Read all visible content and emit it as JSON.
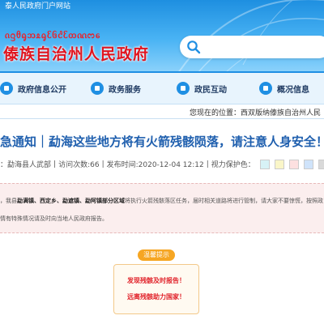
{
  "header": {
    "top_link": "泰人民政府门户网站",
    "script_line": "ᦵᦋᦲᧂᦘᦸᧂᦷᦑᦺᦷᦎᦶᦂᧈ",
    "site_title": "傣族自治州人民政府",
    "search_placeholder": ""
  },
  "nav": {
    "items": [
      {
        "label": "政府信息公开",
        "icon": "document-icon"
      },
      {
        "label": "政务服务",
        "icon": "service-icon"
      },
      {
        "label": "政民互动",
        "icon": "chat-icon"
      },
      {
        "label": "概况信息",
        "icon": "info-icon"
      }
    ]
  },
  "breadcrumb": "您现在的位置：西双版纳傣族自治州人民",
  "article": {
    "title": "急通知｜勐海这些地方将有火箭残骸陨落，请注意人身安全！",
    "meta": {
      "source": "：勐海县人武部",
      "views": "访问次数:66",
      "time": "发布时间:2020-12-04 12:12",
      "vision_label": "视力保护色："
    },
    "swatches": [
      "#d7f2f6",
      "#faf6c8",
      "#fde0e0",
      "#cfe3fa",
      "#d9d9d9"
    ],
    "para_1_prefix": "，我县",
    "para_1_bold": "勐满镇、西定乡、勐遮镇、勐阿镇部分区域",
    "para_1_rest": "将执行火箭残骸落区任务，届时相关道路将进行管制，请大家不要惊慌，按照政",
    "para_2": "情有特殊情况请及时向当地人民政府报告。"
  },
  "notice": {
    "badge": "温馨提示",
    "line_1": "发现残骸及时报告！",
    "line_2": "远离残骸助力国家！"
  },
  "colors": {
    "header_blue": "#1e8fe0",
    "title_red": "#e0151f",
    "link_blue": "#1f5fae"
  }
}
